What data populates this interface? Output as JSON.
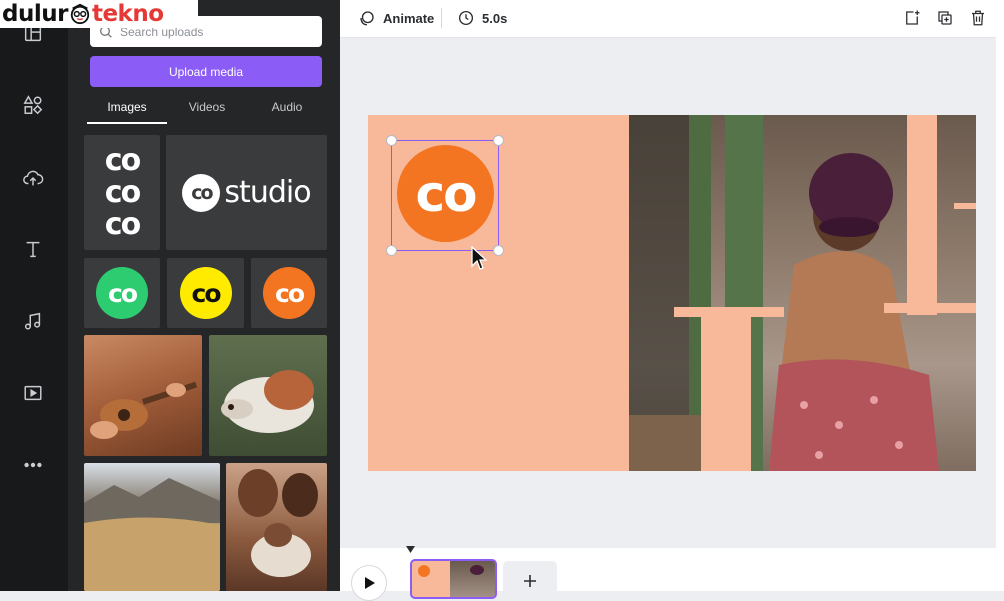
{
  "watermark": {
    "part1": "dulur",
    "part2": "tekno"
  },
  "rail": {
    "items": [
      {
        "icon": "templates-icon"
      },
      {
        "icon": "elements-icon"
      },
      {
        "icon": "uploads-icon"
      },
      {
        "icon": "text-icon"
      },
      {
        "icon": "audio-icon"
      },
      {
        "icon": "videos-icon"
      },
      {
        "icon": "more-icon"
      }
    ]
  },
  "panel": {
    "search_placeholder": "Search uploads",
    "upload_button": "Upload media",
    "tabs": [
      {
        "label": "Images",
        "active": true
      },
      {
        "label": "Videos",
        "active": false
      },
      {
        "label": "Audio",
        "active": false
      }
    ],
    "logos": {
      "stacked_mark": "co",
      "studio_mark": "co",
      "studio_text": "studio",
      "green_mark": "co",
      "yellow_mark": "co",
      "orange_mark": "co"
    },
    "photos": [
      "ukulele-player-photo",
      "dog-photo",
      "desert-landscape-photo",
      "family-baby-photo"
    ]
  },
  "toolbar": {
    "animate_label": "Animate",
    "duration_label": "5.0s"
  },
  "canvas": {
    "background_color": "#f8b99a",
    "logo_mark": "co",
    "logo_color": "#f47521",
    "photo": "woman-in-hat-photo"
  },
  "colors": {
    "accent": "#8b5cf6",
    "green": "#2ecc71",
    "yellow": "#ffeb00",
    "orange": "#f47521"
  }
}
